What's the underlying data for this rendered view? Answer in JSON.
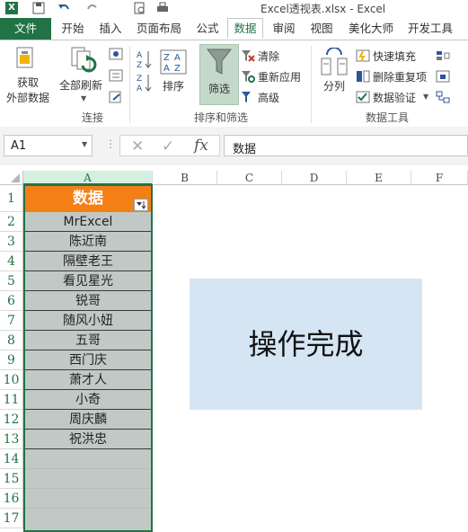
{
  "window": {
    "title": "Excel透视表.xlsx - Excel"
  },
  "tabs": [
    "文件",
    "开始",
    "插入",
    "页面布局",
    "公式",
    "数据",
    "审阅",
    "视图",
    "美化大师",
    "开发工具"
  ],
  "active_tab": "数据",
  "ribbon": {
    "get_external_data": [
      "获取",
      "外部数据"
    ],
    "refresh_all": "全部刷新",
    "connections_group": "连接",
    "sort_label": "排序",
    "filter_label": "筛选",
    "clear_label": "清除",
    "reapply_label": "重新应用",
    "advanced_label": "高级",
    "sort_filter_group": "排序和筛选",
    "split_label": "分列",
    "flash_fill_label": "快速填充",
    "remove_dup_label": "删除重复项",
    "validation_label": "数据验证",
    "data_tools_group": "数据工具"
  },
  "formula_bar": {
    "name_box": "A1",
    "fx": "fx",
    "value": "数据"
  },
  "columns": [
    "A",
    "B",
    "C",
    "D",
    "E",
    "F"
  ],
  "rows": [
    "1",
    "2",
    "3",
    "4",
    "5",
    "6",
    "7",
    "8",
    "9",
    "10",
    "11",
    "12",
    "13",
    "14",
    "15",
    "16",
    "17"
  ],
  "column_a": {
    "header": "数据",
    "values": [
      "MrExcel",
      "陈近南",
      "隔壁老王",
      "看见星光",
      "锐哥",
      "随风小妞",
      "五哥",
      "西门庆",
      "萧才人",
      "小奇",
      "周庆麟",
      "祝洪忠"
    ]
  },
  "message": "操作完成",
  "colors": {
    "accent": "#217346",
    "header_fill": "#f57f17",
    "column_fill": "#c1c9c6",
    "message_fill": "#d6e5f4"
  }
}
